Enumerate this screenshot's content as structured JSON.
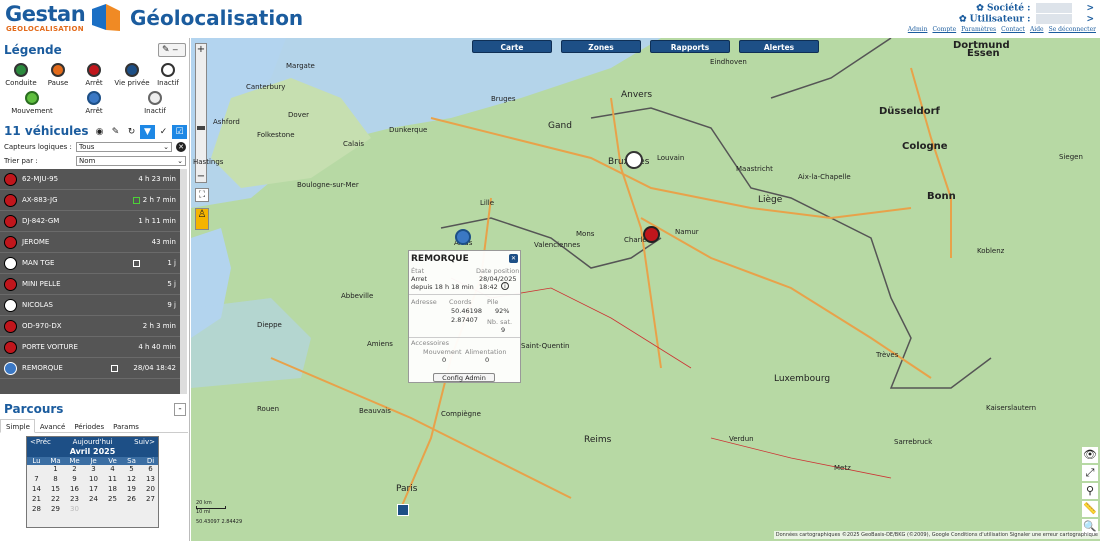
{
  "header": {
    "logo_word": "Gestan",
    "logo_sub": "GEOLOCALISATION",
    "title": "Géolocalisation",
    "societe_label": "Société :",
    "utilisateur_label": "Utilisateur :",
    "links": [
      "Admin",
      "Compte",
      "Paramètres",
      "Contact",
      "Aide",
      "Se déconnecter"
    ]
  },
  "legend": {
    "title": "Légende",
    "items": [
      "Conduite",
      "Pause",
      "Arrêt",
      "Vie privée",
      "Inactif",
      "Mouvement",
      "Arrêt",
      "Inactif"
    ]
  },
  "vehicles": {
    "count_title": "11 véhicules",
    "capteurs_label": "Capteurs logiques :",
    "capteurs_value": "Tous",
    "trier_label": "Trier par :",
    "trier_value": "Nom",
    "rows": [
      {
        "name": "62-MJU-95",
        "time": "4 h 23 min"
      },
      {
        "name": "AX-883-JG",
        "time": "2 h 7 min"
      },
      {
        "name": "DJ-842-GM",
        "time": "1 h 11 min"
      },
      {
        "name": "JEROME",
        "time": "43 min"
      },
      {
        "name": "MAN TGE",
        "time": "1 j"
      },
      {
        "name": "MINI PELLE",
        "time": "5 j"
      },
      {
        "name": "NICOLAS",
        "time": "9 j"
      },
      {
        "name": "OD-970-DX",
        "time": "2 h 3 min"
      },
      {
        "name": "PORTE VOITURE",
        "time": "4 h 40 min"
      },
      {
        "name": "REMORQUE",
        "time": "28/04 18:42"
      }
    ]
  },
  "parcours": {
    "title": "Parcours",
    "tabs": [
      "Simple",
      "Avancé",
      "Périodes",
      "Params"
    ],
    "cal_prev": "<Préc",
    "cal_today": "Aujourd'hui",
    "cal_next": "Suiv>",
    "cal_month": "Avril 2025",
    "days": [
      "Lu",
      "Ma",
      "Me",
      "Je",
      "Ve",
      "Sa",
      "Di"
    ],
    "weeks": [
      [
        "",
        "1",
        "2",
        "3",
        "4",
        "5",
        "6"
      ],
      [
        "7",
        "8",
        "9",
        "10",
        "11",
        "12",
        "13"
      ],
      [
        "14",
        "15",
        "16",
        "17",
        "18",
        "19",
        "20"
      ],
      [
        "21",
        "22",
        "23",
        "24",
        "25",
        "26",
        "27"
      ],
      [
        "28",
        "29",
        "30",
        "",
        "",
        "",
        ""
      ]
    ]
  },
  "map": {
    "buttons": [
      "Carte",
      "Zones",
      "Rapports",
      "Alertes"
    ],
    "popup": {
      "title": "REMORQUE",
      "etat_label": "État",
      "etat_value": "Arret",
      "depuis": "depuis 18 h 18 min",
      "date_label": "Date position",
      "date_value": "28/04/2025",
      "time_value": "18:42",
      "adresse_label": "Adresse",
      "coords_label": "Coords",
      "coord_lat": "50.46198",
      "coord_lon": "2.87407",
      "pile_label": "Pile",
      "pile_value": "92%",
      "sat_label": "Nb. sat.",
      "sat_value": "9",
      "acc_label": "Accessoires",
      "mouvement_label": "Mouvement",
      "mouvement_value": "0",
      "alim_label": "Alimentation",
      "alim_value": "0",
      "config_btn": "Config Admin"
    },
    "cities": [
      "Dortmund",
      "Essen",
      "Düsseldorf",
      "Cologne",
      "Bonn",
      "Anvers",
      "Gand",
      "Bruges",
      "Bruxelles",
      "Louvain",
      "Liège",
      "Namur",
      "Charleroi",
      "Mons",
      "Lille",
      "Maastricht",
      "Aix-la-Chapelle",
      "Luxembourg",
      "Reims",
      "Paris",
      "Amiens",
      "Rouen",
      "Calais",
      "Dunkerque",
      "Boulogne-sur-Mer",
      "Eindhoven",
      "Siegen",
      "Koblenz",
      "Trèves",
      "Sarrebruck",
      "Kaiserslautern",
      "Metz",
      "Verdun",
      "Compiègne",
      "Beauvais",
      "Abbeville",
      "Dieppe",
      "Arras",
      "Saint-Quentin",
      "Valenciennes",
      "Canterbury",
      "Margate",
      "Hastings",
      "Ashford",
      "Folkestone",
      "Dover"
    ],
    "scale_km": "20 km",
    "scale_mi": "10 mi",
    "scale_coords": "50.43097  2.84429",
    "credits": "Données cartographiques ©2025 GeoBasis-DE/BKG (©2009), Google   Conditions d'utilisation   Signaler une erreur cartographique"
  }
}
